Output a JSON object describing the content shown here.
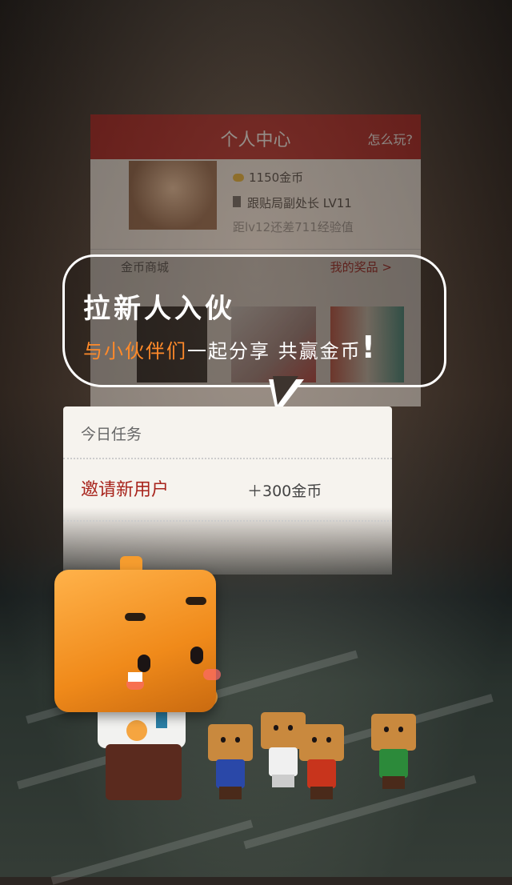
{
  "app_panel": {
    "header_title": "个人中心",
    "help_link": "怎么玩?",
    "coins": "1150金币",
    "rank": "跟贴局副处长  LV11",
    "next_level": "距lv12还差711经验值",
    "mall_label": "金币商城",
    "my_prizes": "我的奖品 >"
  },
  "promo": {
    "headline": "拉新人入伙",
    "sub_accent": "与小伙伴们",
    "sub_rest": "一起分享 共赢金币",
    "sub_bang": "!",
    "accent_color": "#ff8a2a"
  },
  "task_card": {
    "title": "今日任务",
    "task_name": "邀请新用户",
    "task_reward": "＋300金币",
    "task_color": "#a8241c"
  },
  "brand_color": "#b01414",
  "icons": [
    "coin-icon",
    "rank-badge-icon",
    "chevron-right-icon"
  ]
}
